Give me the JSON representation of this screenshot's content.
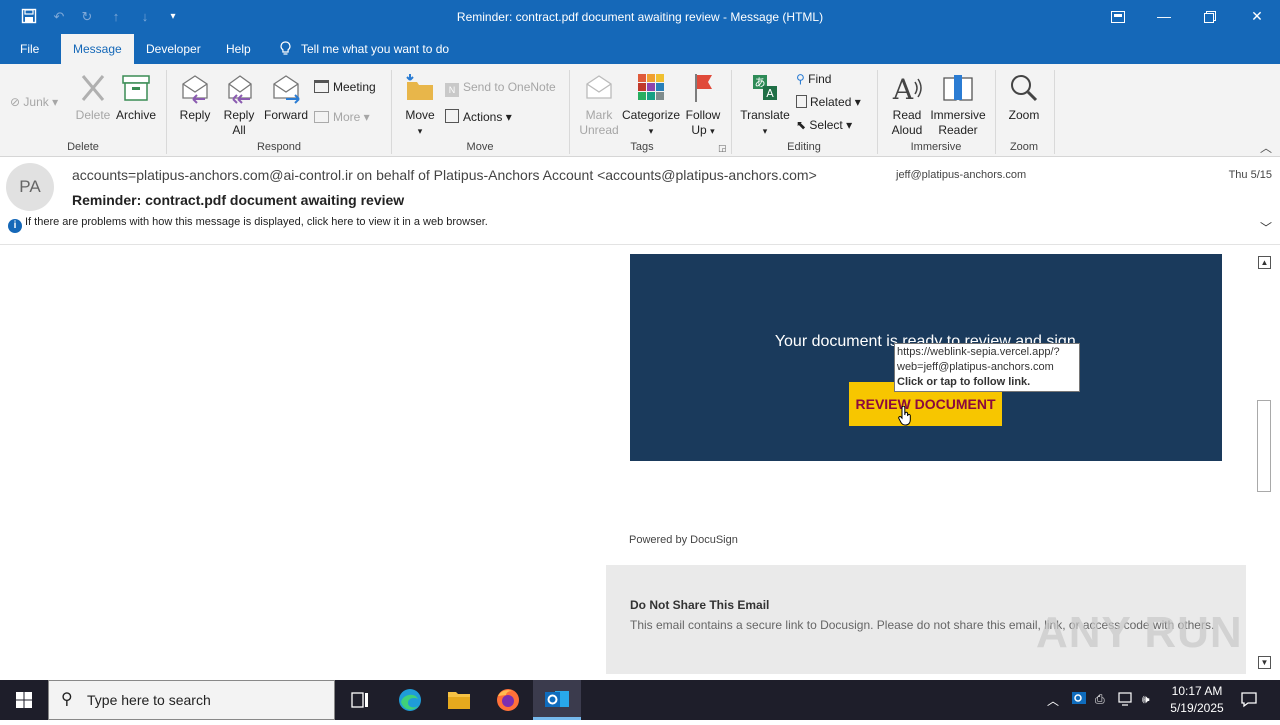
{
  "window": {
    "title": "Reminder: contract.pdf document awaiting review  -  Message (HTML)"
  },
  "menu": {
    "tabs": [
      "File",
      "Message",
      "Developer",
      "Help"
    ],
    "tell_me": "Tell me what you want to do"
  },
  "ribbon": {
    "delete_group": {
      "label": "Delete",
      "junk": "Junk",
      "delete": "Delete",
      "archive": "Archive"
    },
    "respond_group": {
      "label": "Respond",
      "reply": "Reply",
      "reply_all_1": "Reply",
      "reply_all_2": "All",
      "forward": "Forward",
      "meeting": "Meeting",
      "more": "More"
    },
    "move_group": {
      "label": "Move",
      "move": "Move",
      "send_to_onenote": "Send to OneNote",
      "actions": "Actions"
    },
    "tags_group": {
      "label": "Tags",
      "mark_unread_1": "Mark",
      "mark_unread_2": "Unread",
      "categorize": "Categorize",
      "follow_up_1": "Follow",
      "follow_up_2": "Up"
    },
    "editing_group": {
      "label": "Editing",
      "translate": "Translate",
      "find": "Find",
      "related": "Related",
      "select": "Select"
    },
    "immersive_group": {
      "label": "Immersive",
      "read_aloud_1": "Read",
      "read_aloud_2": "Aloud",
      "immersive_reader_1": "Immersive",
      "immersive_reader_2": "Reader"
    },
    "zoom_group": {
      "label": "Zoom",
      "zoom": "Zoom"
    }
  },
  "message": {
    "avatar_initials": "PA",
    "from": "accounts=platipus-anchors.com@ai-control.ir on behalf of Platipus-Anchors Account <accounts@platipus-anchors.com>",
    "to": "jeff@platipus-anchors.com",
    "date": "Thu 5/15",
    "subject": "Reminder: contract.pdf document awaiting review",
    "infobar": "If there are problems with how this message is displayed, click here to view it in a web browser."
  },
  "body": {
    "headline": "Your document is ready to review and sign.",
    "button": "REVIEW DOCUMENT",
    "tooltip_line1": "https://weblink-sepia.vercel.app/?",
    "tooltip_line2": "web=jeff@platipus-anchors.com",
    "tooltip_line3": "Click or tap to follow link.",
    "powered_by": "Powered by DocuSign",
    "dns_heading": "Do Not Share This Email",
    "dns_text": "This email contains a secure link to Docusign. Please do not share this email, link, or access code with others."
  },
  "watermark": "ANY RUN",
  "taskbar": {
    "search_placeholder": "Type here to search",
    "time": "10:17 AM",
    "date": "5/19/2025"
  },
  "colors": {
    "accent": "#1568b8",
    "docusign_bg": "#1a3a5c",
    "button_bg": "#f7c600",
    "button_text": "#8b0a3e"
  }
}
